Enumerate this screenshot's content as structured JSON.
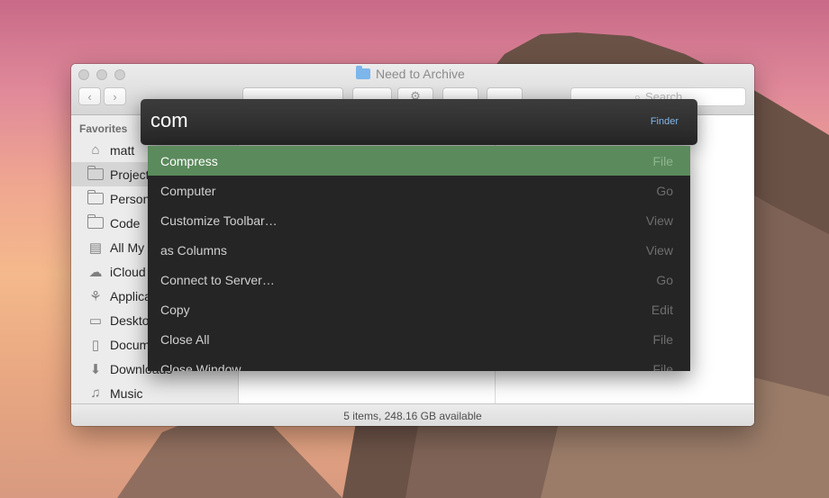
{
  "window": {
    "title": "Need to Archive",
    "search_placeholder": "Search"
  },
  "sidebar": {
    "heading": "Favorites",
    "items": [
      {
        "label": "matt",
        "icon": "home-icon"
      },
      {
        "label": "Projects",
        "icon": "folder-icon",
        "selected": true
      },
      {
        "label": "Personal",
        "icon": "folder-icon"
      },
      {
        "label": "Code",
        "icon": "folder-icon"
      },
      {
        "label": "All My Files",
        "icon": "all-files-icon"
      },
      {
        "label": "iCloud Drive",
        "icon": "cloud-icon"
      },
      {
        "label": "Applications",
        "icon": "applications-icon"
      },
      {
        "label": "Desktop",
        "icon": "desktop-icon"
      },
      {
        "label": "Documents",
        "icon": "documents-icon"
      },
      {
        "label": "Downloads",
        "icon": "downloads-icon"
      },
      {
        "label": "Music",
        "icon": "music-icon"
      }
    ]
  },
  "status": {
    "text": "5 items, 248.16 GB available"
  },
  "palette": {
    "query": "com",
    "scope": "Finder",
    "results": [
      {
        "label": "Compress",
        "category": "File",
        "selected": true
      },
      {
        "label": "Computer",
        "category": "Go"
      },
      {
        "label": "Customize Toolbar…",
        "category": "View"
      },
      {
        "label": "as Columns",
        "category": "View"
      },
      {
        "label": "Connect to Server…",
        "category": "Go"
      },
      {
        "label": "Copy",
        "category": "Edit"
      },
      {
        "label": "Close All",
        "category": "File"
      },
      {
        "label": "Close Window",
        "category": "File"
      }
    ]
  },
  "colors": {
    "selected_result": "#5b8a5c",
    "scope_label": "#7fb6ea",
    "palette_bg": "#252525"
  }
}
